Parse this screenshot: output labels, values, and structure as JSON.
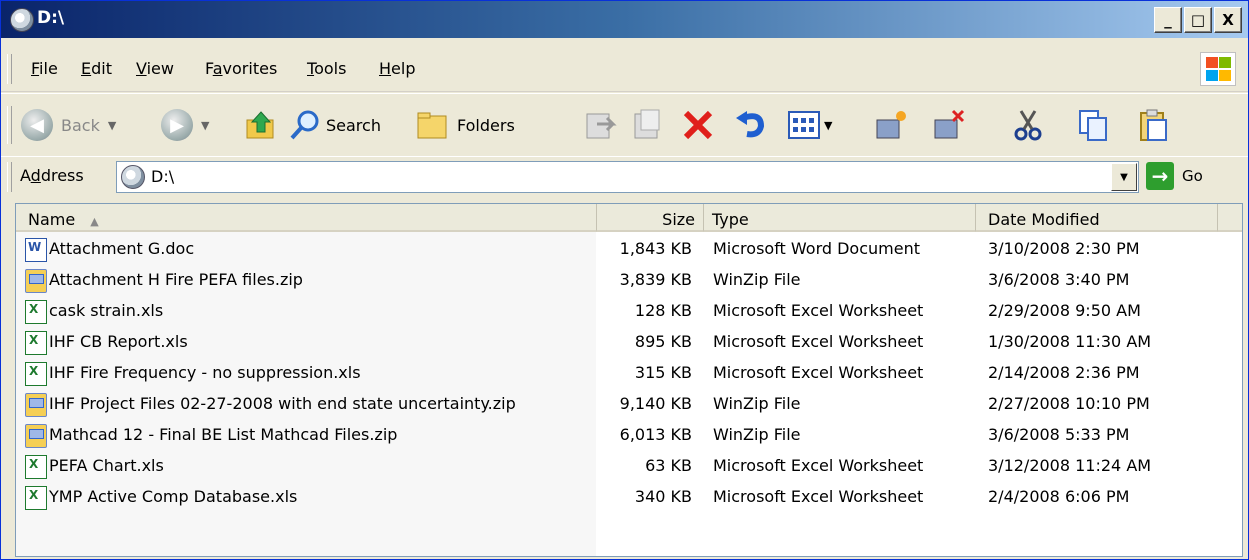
{
  "window": {
    "title": "D:\\",
    "minimize": "_",
    "maximize": "□",
    "close": "X"
  },
  "menu": [
    {
      "pre": "",
      "acc": "F",
      "post": "ile"
    },
    {
      "pre": "",
      "acc": "E",
      "post": "dit"
    },
    {
      "pre": "",
      "acc": "V",
      "post": "iew"
    },
    {
      "pre": "F",
      "acc": "a",
      "post": "vorites"
    },
    {
      "pre": "",
      "acc": "T",
      "post": "ools"
    },
    {
      "pre": "",
      "acc": "H",
      "post": "elp"
    }
  ],
  "toolbar": {
    "back": "Back",
    "search": "Search",
    "folders": "Folders"
  },
  "address": {
    "label_pre": "A",
    "label_acc": "d",
    "label_post": "dress",
    "value": "D:\\",
    "go": "Go"
  },
  "columns": {
    "name": "Name",
    "size": "Size",
    "type": "Type",
    "date": "Date Modified"
  },
  "files": [
    {
      "name": "Attachment G.doc",
      "size": "1,843 KB",
      "type": "Microsoft Word Document",
      "date": "3/10/2008 2:30 PM",
      "icon": "word-doc-icon"
    },
    {
      "name": "Attachment H Fire PEFA files.zip",
      "size": "3,839 KB",
      "type": "WinZip File",
      "date": "3/6/2008 3:40 PM",
      "icon": "zip-file-icon"
    },
    {
      "name": "cask strain.xls",
      "size": "128 KB",
      "type": "Microsoft Excel Worksheet",
      "date": "2/29/2008 9:50 AM",
      "icon": "excel-file-icon"
    },
    {
      "name": "IHF CB Report.xls",
      "size": "895 KB",
      "type": "Microsoft Excel Worksheet",
      "date": "1/30/2008 11:30 AM",
      "icon": "excel-file-icon"
    },
    {
      "name": "IHF Fire Frequency - no suppression.xls",
      "size": "315 KB",
      "type": "Microsoft Excel Worksheet",
      "date": "2/14/2008 2:36 PM",
      "icon": "excel-file-icon"
    },
    {
      "name": "IHF Project Files 02-27-2008 with end state uncertainty.zip",
      "size": "9,140 KB",
      "type": "WinZip File",
      "date": "2/27/2008 10:10 PM",
      "icon": "zip-file-icon"
    },
    {
      "name": "Mathcad 12 -  Final BE List Mathcad Files.zip",
      "size": "6,013 KB",
      "type": "WinZip File",
      "date": "3/6/2008 5:33 PM",
      "icon": "zip-file-icon"
    },
    {
      "name": "PEFA Chart.xls",
      "size": "63 KB",
      "type": "Microsoft Excel Worksheet",
      "date": "3/12/2008 11:24 AM",
      "icon": "excel-file-icon"
    },
    {
      "name": "YMP Active Comp Database.xls",
      "size": "340 KB",
      "type": "Microsoft Excel Worksheet",
      "date": "2/4/2008 6:06 PM",
      "icon": "excel-file-icon"
    }
  ]
}
